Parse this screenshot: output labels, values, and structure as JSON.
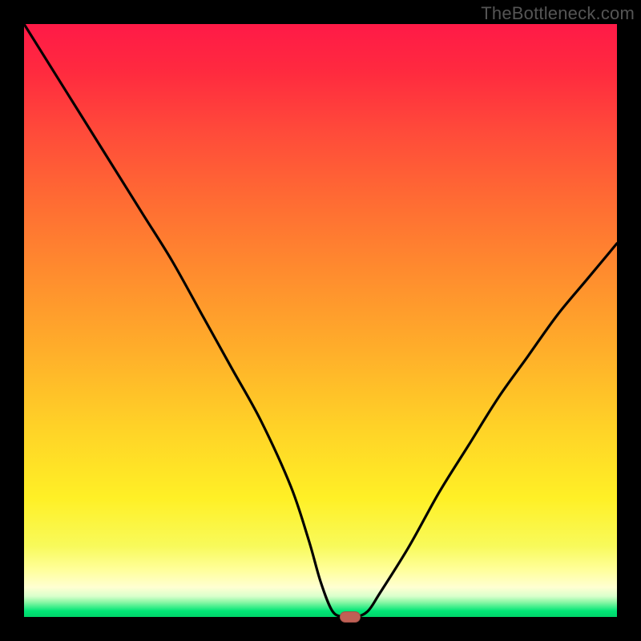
{
  "watermark": "TheBottleneck.com",
  "colors": {
    "frame_bg": "#000000",
    "curve": "#000000",
    "marker": "#c06055",
    "watermark_text": "#555555"
  },
  "chart_data": {
    "type": "line",
    "title": "",
    "xlabel": "",
    "ylabel": "",
    "xlim": [
      0,
      100
    ],
    "ylim": [
      0,
      100
    ],
    "grid": false,
    "x": [
      0,
      5,
      10,
      15,
      20,
      25,
      30,
      35,
      40,
      45,
      48,
      50,
      52,
      54,
      56,
      58,
      60,
      65,
      70,
      75,
      80,
      85,
      90,
      95,
      100
    ],
    "values": [
      100,
      92,
      84,
      76,
      68,
      60,
      51,
      42,
      33,
      22,
      13,
      6,
      1,
      0,
      0,
      1,
      4,
      12,
      21,
      29,
      37,
      44,
      51,
      57,
      63
    ],
    "marker": {
      "x": 55,
      "y": 0
    },
    "note": "Approximate V-shaped bottleneck curve; minimum (≈0) near x≈55; left branch reaches ~100 at x=0; right branch reaches ~63 at x=100."
  }
}
